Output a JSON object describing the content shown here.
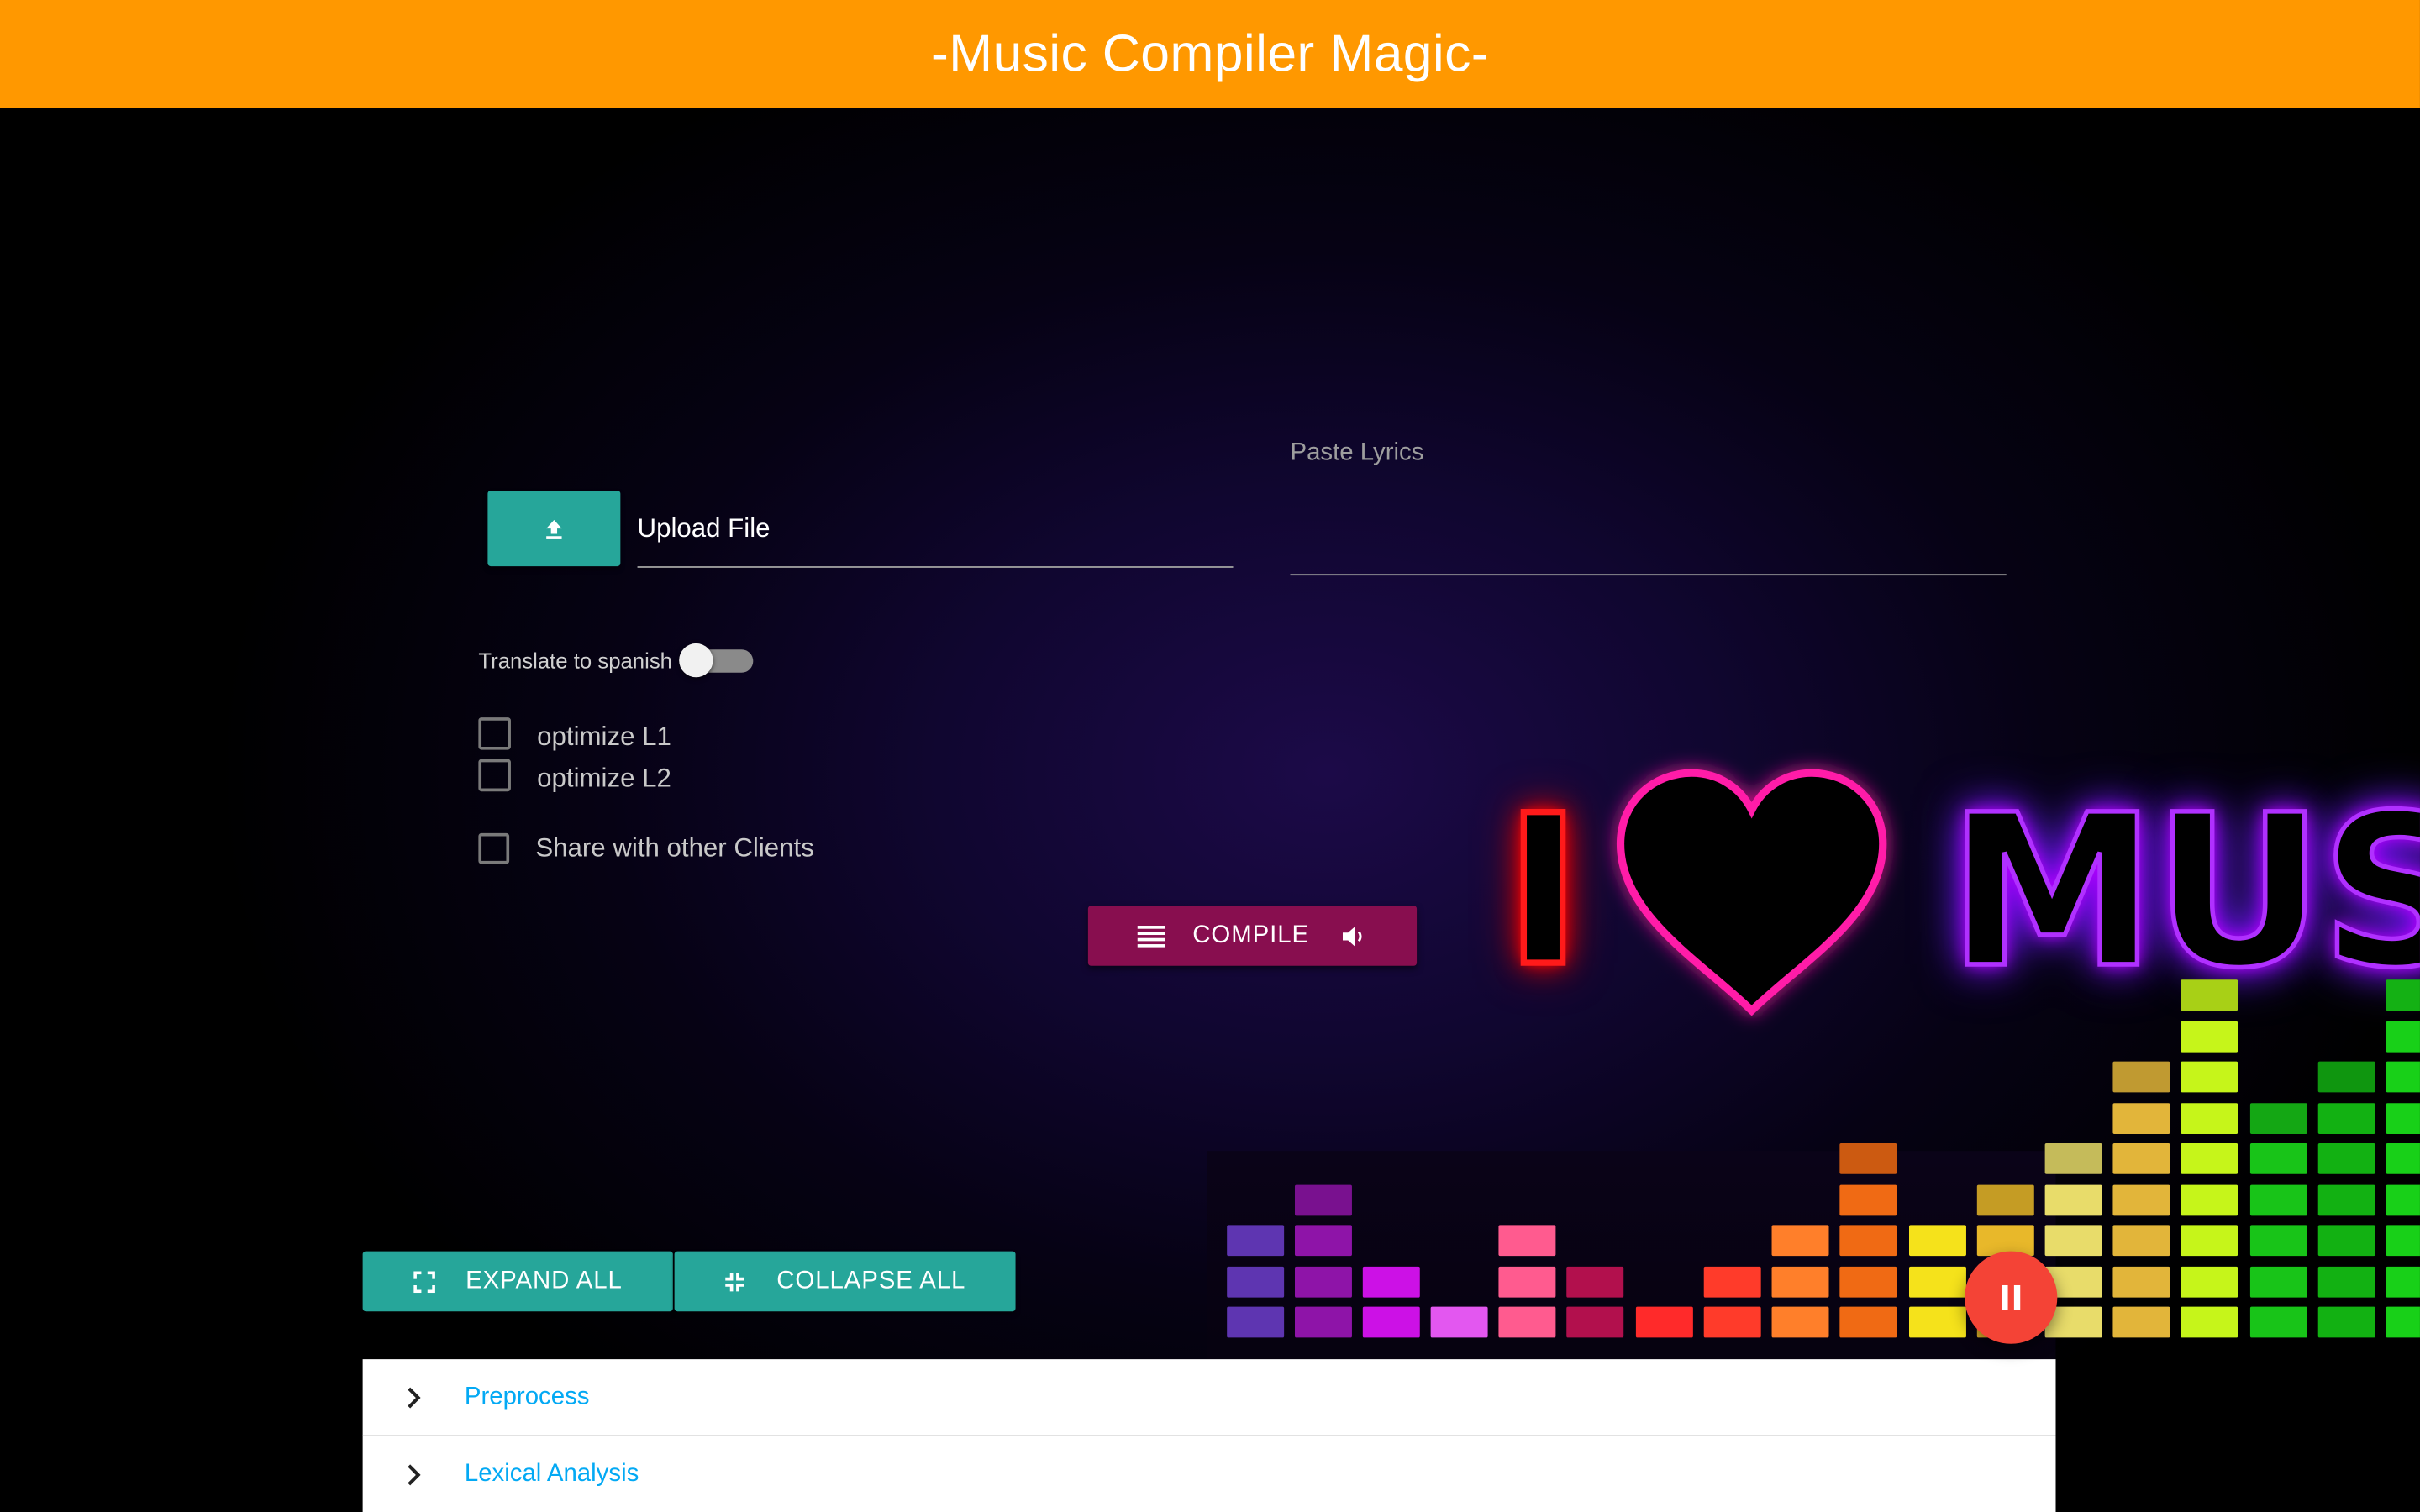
{
  "app": {
    "title": "-Music Compiler Magic-"
  },
  "upload": {
    "label": "Upload File",
    "button_icon": "upload-icon"
  },
  "lyrics": {
    "label": "Paste Lyrics",
    "value": ""
  },
  "translate": {
    "label": "Translate to spanish",
    "checked": false
  },
  "options": {
    "optimize_l1": {
      "label": "optimize L1",
      "checked": false
    },
    "optimize_l2": {
      "label": "optimize L2",
      "checked": false
    },
    "share": {
      "label": "Share with other Clients",
      "checked": false
    }
  },
  "compile": {
    "label": "COMPILE",
    "left_icon": "list-icon",
    "right_icon": "volume-icon"
  },
  "banner": {
    "i": "I",
    "word": "MUS",
    "heart_icon": "heart-icon"
  },
  "actions": {
    "expand_all": {
      "label": "EXPAND ALL",
      "icon": "fullscreen-icon"
    },
    "collapse_all": {
      "label": "COLLAPSE ALL",
      "icon": "fullscreen-exit-icon"
    }
  },
  "sections": [
    {
      "label": "Preprocess"
    },
    {
      "label": "Lexical Analysis"
    }
  ],
  "fab": {
    "icon": "pause-icon"
  },
  "colors": {
    "header": "#ff9800",
    "teal": "#26a69a",
    "compile": "#880e4f",
    "link": "#03a9f4",
    "fab": "#f44336"
  }
}
